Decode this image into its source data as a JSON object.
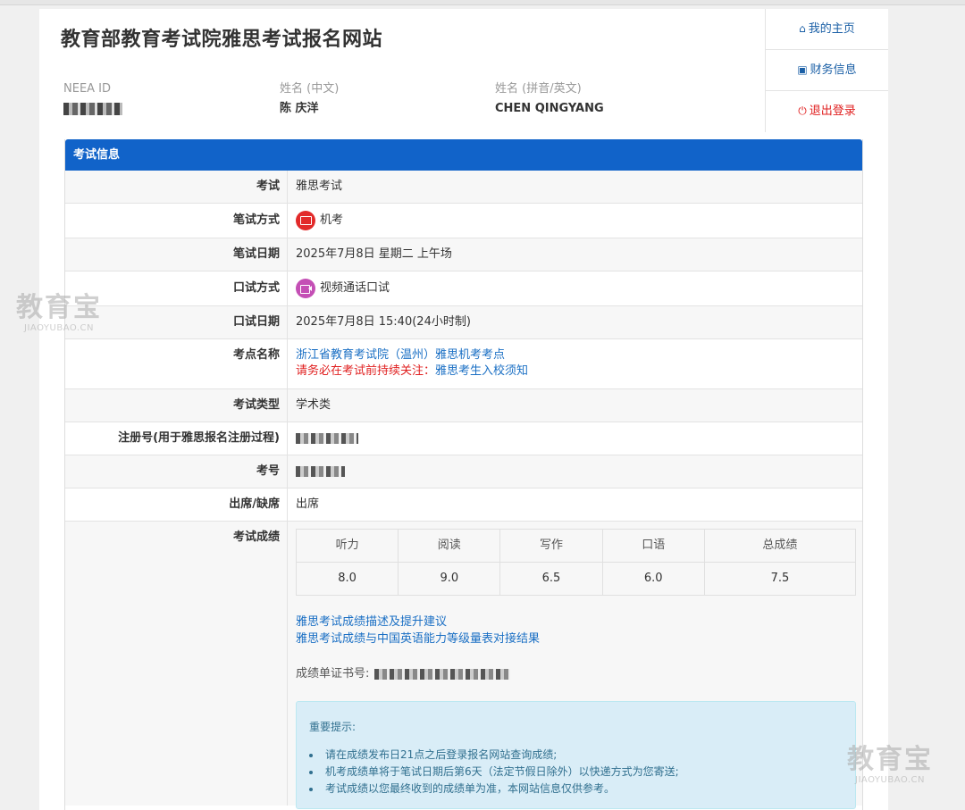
{
  "site": {
    "title": "教育部教育考试院雅思考试报名网站"
  },
  "profile": {
    "neea_label": "NEEA ID",
    "name_cn_label": "姓名 (中文)",
    "name_cn": "陈 庆洋",
    "name_en_label": "姓名 (拼音/英文)",
    "name_en": "CHEN QINGYANG"
  },
  "nav": {
    "home": "我的主页",
    "finance": "财务信息",
    "logout": "退出登录"
  },
  "panel": {
    "title": "考试信息"
  },
  "rows": {
    "exam_k": "考试",
    "exam_v": "雅思考试",
    "written_mode_k": "笔试方式",
    "written_mode_v": "机考",
    "written_date_k": "笔试日期",
    "written_date_v": "2025年7月8日 星期二  上午场",
    "speaking_mode_k": "口试方式",
    "speaking_mode_v": "视频通话口试",
    "speaking_date_k": "口试日期",
    "speaking_date_v": "2025年7月8日 15:40(24小时制)",
    "venue_k": "考点名称",
    "venue_v": "浙江省教育考试院（温州）雅思机考考点",
    "venue_warn": "请务必在考试前持续关注：",
    "venue_link": "雅思考生入校须知",
    "type_k": "考试类型",
    "type_v": "学术类",
    "reg_k": "注册号(用于雅思报名注册过程)",
    "candidate_k": "考号",
    "attend_k": "出席/缺席",
    "attend_v": "出席",
    "score_k": "考试成绩"
  },
  "scores": {
    "headers": [
      "听力",
      "阅读",
      "写作",
      "口语",
      "总成绩"
    ],
    "values": [
      "8.0",
      "9.0",
      "6.5",
      "6.0",
      "7.5"
    ]
  },
  "links": {
    "desc": "雅思考试成绩描述及提升建议",
    "compare": "雅思考试成绩与中国英语能力等级量表对接结果"
  },
  "cert": {
    "label": "成绩单证书号:"
  },
  "notice": {
    "title": "重要提示:",
    "items": [
      "请在成绩发布日21点之后登录报名网站查询成绩;",
      "机考成绩单将于笔试日期后第6天（法定节假日除外）以快递方式为您寄送;",
      "考试成绩以您最终收到的成绩单为准，本网站信息仅供参考。"
    ]
  },
  "watermark": {
    "big": "教育宝",
    "small": "JIAOYUBAO.CN"
  },
  "colors": {
    "accent": "#1163c9",
    "link": "#1a6fc4",
    "danger": "#e02020"
  }
}
